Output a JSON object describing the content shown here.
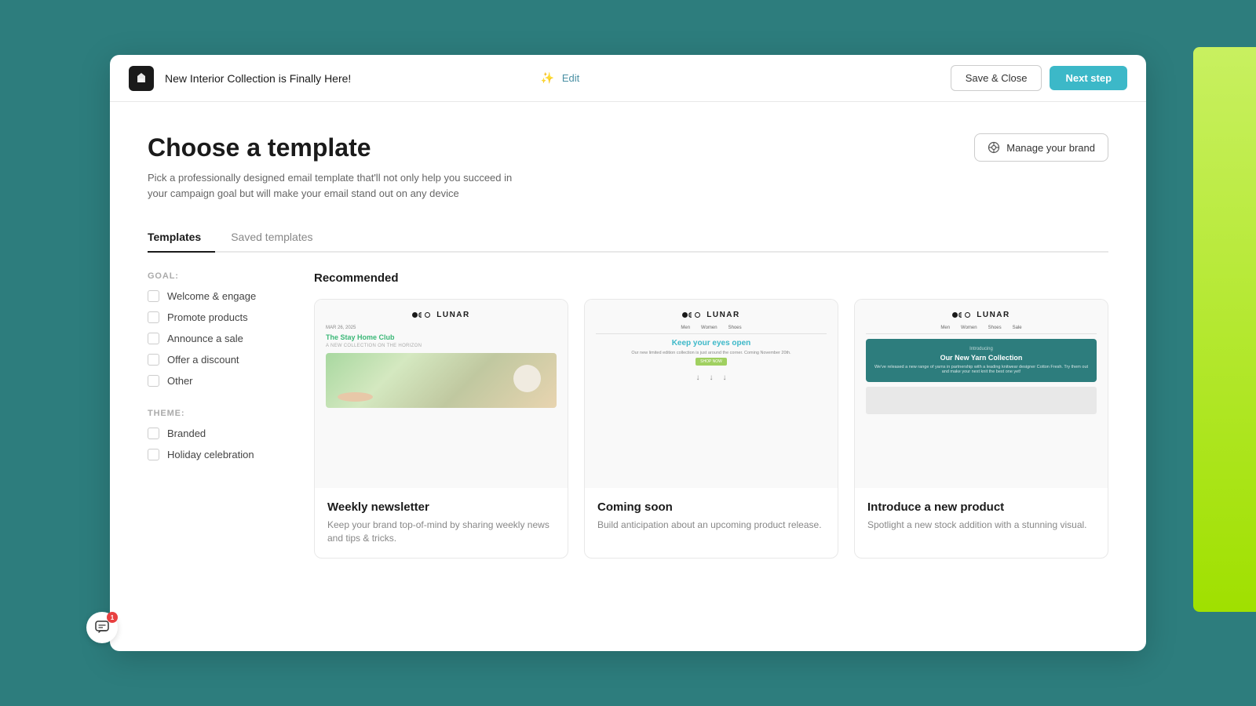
{
  "header": {
    "title": "New Interior Collection is Finally Here!",
    "sparkle": "✨",
    "edit_label": "Edit",
    "save_close_label": "Save & Close",
    "next_step_label": "Next step"
  },
  "page": {
    "title": "Choose a template",
    "description": "Pick a professionally designed email template that'll not only help you succeed in your campaign goal but will make your email stand out on any device",
    "manage_brand_label": "Manage your brand"
  },
  "tabs": [
    {
      "label": "Templates",
      "active": true
    },
    {
      "label": "Saved templates",
      "active": false
    }
  ],
  "filters": {
    "goal_label": "GOAL:",
    "theme_label": "THEME:",
    "goal_items": [
      {
        "label": "Welcome & engage"
      },
      {
        "label": "Promote products"
      },
      {
        "label": "Announce a sale"
      },
      {
        "label": "Offer a discount"
      },
      {
        "label": "Other"
      }
    ],
    "theme_items": [
      {
        "label": "Branded"
      },
      {
        "label": "Holiday celebration"
      }
    ]
  },
  "templates": {
    "section_label": "Recommended",
    "items": [
      {
        "id": "weekly-newsletter",
        "title": "Weekly newsletter",
        "description": "Keep your brand top-of-mind by sharing weekly news and tips & tricks.",
        "preview_type": "newsletter",
        "email_date": "MAR 26, 2025",
        "email_headline": "The Stay Home Club",
        "email_subline": "A NEW COLLECTION ON THE HORIZON"
      },
      {
        "id": "coming-soon",
        "title": "Coming soon",
        "description": "Build anticipation about an upcoming product release.",
        "preview_type": "coming-soon",
        "nav_items": [
          "Men",
          "Women",
          "Shoes"
        ],
        "email_headline": "Keep your eyes open",
        "email_body": "Our new limited edition collection is just around the corner. Coming November 20th.",
        "email_badge": "SHOP NOW"
      },
      {
        "id": "new-product",
        "title": "Introduce a new product",
        "description": "Spotlight a new stock addition with a stunning visual.",
        "preview_type": "new-product",
        "nav_items": [
          "Men",
          "Women",
          "Shoes",
          "Sale"
        ],
        "email_intro": "Introducing",
        "email_headline": "Our New Yarn Collection",
        "email_body": "We've released a new range of yarns in partnership with a leading knitwear designer Cotton Fresh. Try them out and make your next knit the best one yet!"
      }
    ]
  },
  "chat": {
    "badge_count": "1"
  }
}
